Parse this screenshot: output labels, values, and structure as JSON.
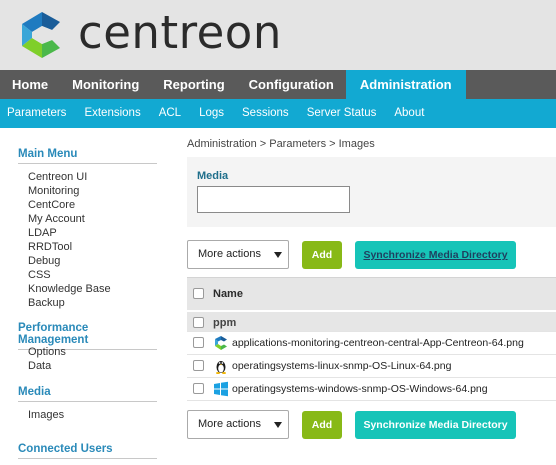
{
  "brand": {
    "logo_text": "centreon"
  },
  "top_nav": [
    "Home",
    "Monitoring",
    "Reporting",
    "Configuration",
    "Administration"
  ],
  "sub_nav": [
    "Parameters",
    "Extensions",
    "ACL",
    "Logs",
    "Sessions",
    "Server Status",
    "About"
  ],
  "sidebar": {
    "main_menu": {
      "title": "Main Menu",
      "items": [
        "Centreon UI",
        "Monitoring",
        "CentCore",
        "My Account",
        "LDAP",
        "RRDTool",
        "Debug",
        "CSS",
        "Knowledge Base",
        "Backup"
      ]
    },
    "performance": {
      "title": "Performance Management",
      "items": [
        "Options",
        "Data"
      ]
    },
    "media": {
      "title": "Media",
      "items": [
        "Images"
      ]
    },
    "connected": {
      "title": "Connected Users"
    }
  },
  "breadcrumb": "Administration  >  Parameters  >  Images",
  "filter": {
    "label": "Media",
    "value": ""
  },
  "actions": {
    "more_actions": "More actions",
    "add": "Add",
    "sync": "Synchronize Media Directory"
  },
  "table": {
    "header": "Name",
    "group": "ppm",
    "rows": [
      {
        "icon": "centreon-logo-icon",
        "file": "applications-monitoring-centreon-central-App-Centreon-64.png"
      },
      {
        "icon": "linux-tux-icon",
        "file": "operatingsystems-linux-snmp-OS-Linux-64.png"
      },
      {
        "icon": "windows-logo-icon",
        "file": "operatingsystems-windows-snmp-OS-Windows-64.png"
      }
    ]
  },
  "colors": {
    "top_nav_bg": "#5a5a5a",
    "accent_blue": "#12a9d2",
    "add_green": "#88b917",
    "sync_teal": "#16c4b8",
    "section_title": "#2a8ab9"
  }
}
